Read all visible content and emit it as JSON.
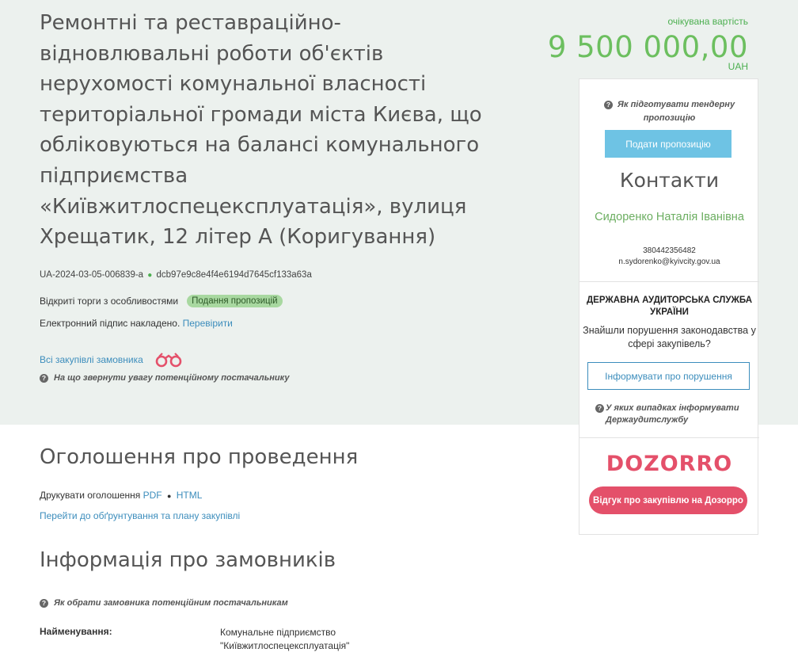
{
  "tender": {
    "title": "Ремонтні та реставраційно-відновлювальні роботи об'єктів нерухомості комунальної власності територіальної громади міста Києва, що обліковуються на балансі комунального підприємства «Київжитлоспецексплуатація», вулиця Хрещатик, 12 літер А (Коригування)",
    "id": "UA-2024-03-05-006839-a",
    "hash": "dcb97e9c8e4f4e6194d7645cf133a63a",
    "procedure_type": "Відкриті торги з особливостями",
    "status": "Подання пропозицій",
    "signature_text": "Електронний підпис накладено.",
    "verify_link": "Перевірити",
    "all_procurements_link": "Всі закупівлі замовника",
    "supplier_hint": "На що звернути увагу потенційному постачальнику"
  },
  "price": {
    "label": "очікувана вартість",
    "value": "9 500 000,00",
    "currency": "UAH"
  },
  "sidebar": {
    "prepare_hint": "Як підготувати тендерну пропозицію",
    "submit_button": "Подати пропозицію",
    "contacts_title": "Контакти",
    "contact_name": "Сидоренко Наталія Іванівна",
    "contact_phone": "380442356482",
    "contact_email": "n.sydorenko@kyivcity.gov.ua",
    "audit_title": "ДЕРЖАВНА АУДИТОРСЬКА СЛУЖБА УКРАЇНИ",
    "audit_text": "Знайшли порушення законодавства у сфері закупівель?",
    "report_button": "Інформувати про порушення",
    "audit_hint": "У яких випадках інформувати Держаудитслужбу",
    "dozorro_logo": "DOZORRO",
    "dozorro_button": "Відгук про закупівлю на Дозорро"
  },
  "announcement": {
    "heading": "Оголошення про проведення",
    "print_label": "Друкувати оголошення",
    "pdf_link": "PDF",
    "html_link": "HTML",
    "plan_link": "Перейти до обґрунтування та плану закупівлі"
  },
  "customers": {
    "heading": "Інформація про замовників",
    "hint": "Як обрати замовника потенційним постачальникам",
    "name_label": "Найменування:",
    "name_line1": "Комунальне підприємство",
    "name_line2": "\"Київжитлоспецексплуатація\""
  },
  "colors": {
    "band": "#ecf1ee",
    "accent_green": "#6cbf5f",
    "link_blue": "#3c8dbc",
    "submit_blue": "#6ec3e4",
    "dozorro_red": "#e4506a"
  }
}
